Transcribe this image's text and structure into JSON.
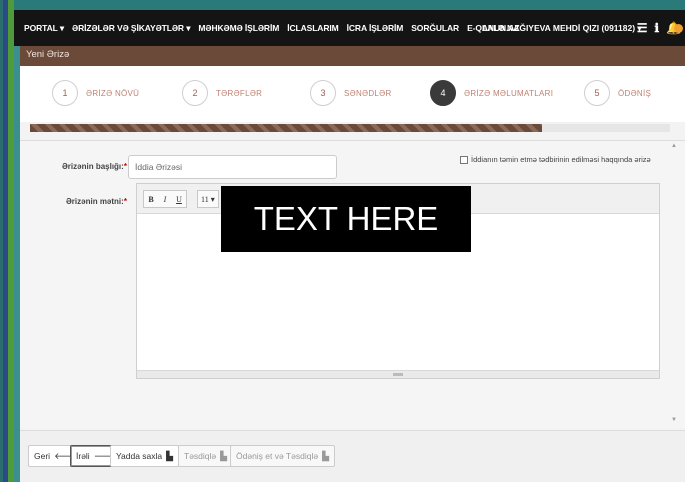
{
  "nav": {
    "items": [
      "PORTAL ▾",
      "ƏRİZƏLƏR VƏ ŞİKAYƏTLƏR ▾",
      "MƏHKƏMƏ İŞLƏRİM",
      "İCLASLARIM",
      "İCRA İŞLƏRİM",
      "SORĞULAR",
      "E-QANUN.AZ"
    ],
    "user": "LALƏ NAĞIYEVA MEHDİ QIZI (091182) ▾"
  },
  "panel": {
    "title": "Yeni Ərizə"
  },
  "steps": [
    {
      "num": "1",
      "label": "ƏRİZƏ NÖVÜ"
    },
    {
      "num": "2",
      "label": "TƏRƏFLƏR"
    },
    {
      "num": "3",
      "label": "SƏNƏDLƏR"
    },
    {
      "num": "4",
      "label": "ƏRİZƏ MƏLUMATLARI",
      "active": true
    },
    {
      "num": "5",
      "label": "ÖDƏNİŞ"
    }
  ],
  "progress": {
    "fraction": 0.8
  },
  "form": {
    "title_label": "Ərizənin başlığı:",
    "title_value": "İddia Ərizəsi",
    "checkbox_label": "İddianın təmin etmə tədbirinin edilməsi haqqında ərizə",
    "text_label": "Ərizənin mətni:",
    "required_mark": "*"
  },
  "toolbar": {
    "bold": "B",
    "italic": "I",
    "underline": "U",
    "font_size": "11 ▾",
    "font_color": "A",
    "color_caret": "▾",
    "list": "≡",
    "align": "≡ ▾",
    "image": "▣",
    "hr": "━"
  },
  "overlay": {
    "text": "TEXT HERE"
  },
  "buttons": {
    "back": "Geri",
    "next": "İrəli",
    "save": "Yadda saxla",
    "confirm": "Təsdiqlə",
    "pay_confirm": "Ödəniş et və Təsdiqlə"
  },
  "colors": {
    "navbar": "#141414",
    "panel_header": "#6b4a3a",
    "accent": "#6b4a3a"
  }
}
